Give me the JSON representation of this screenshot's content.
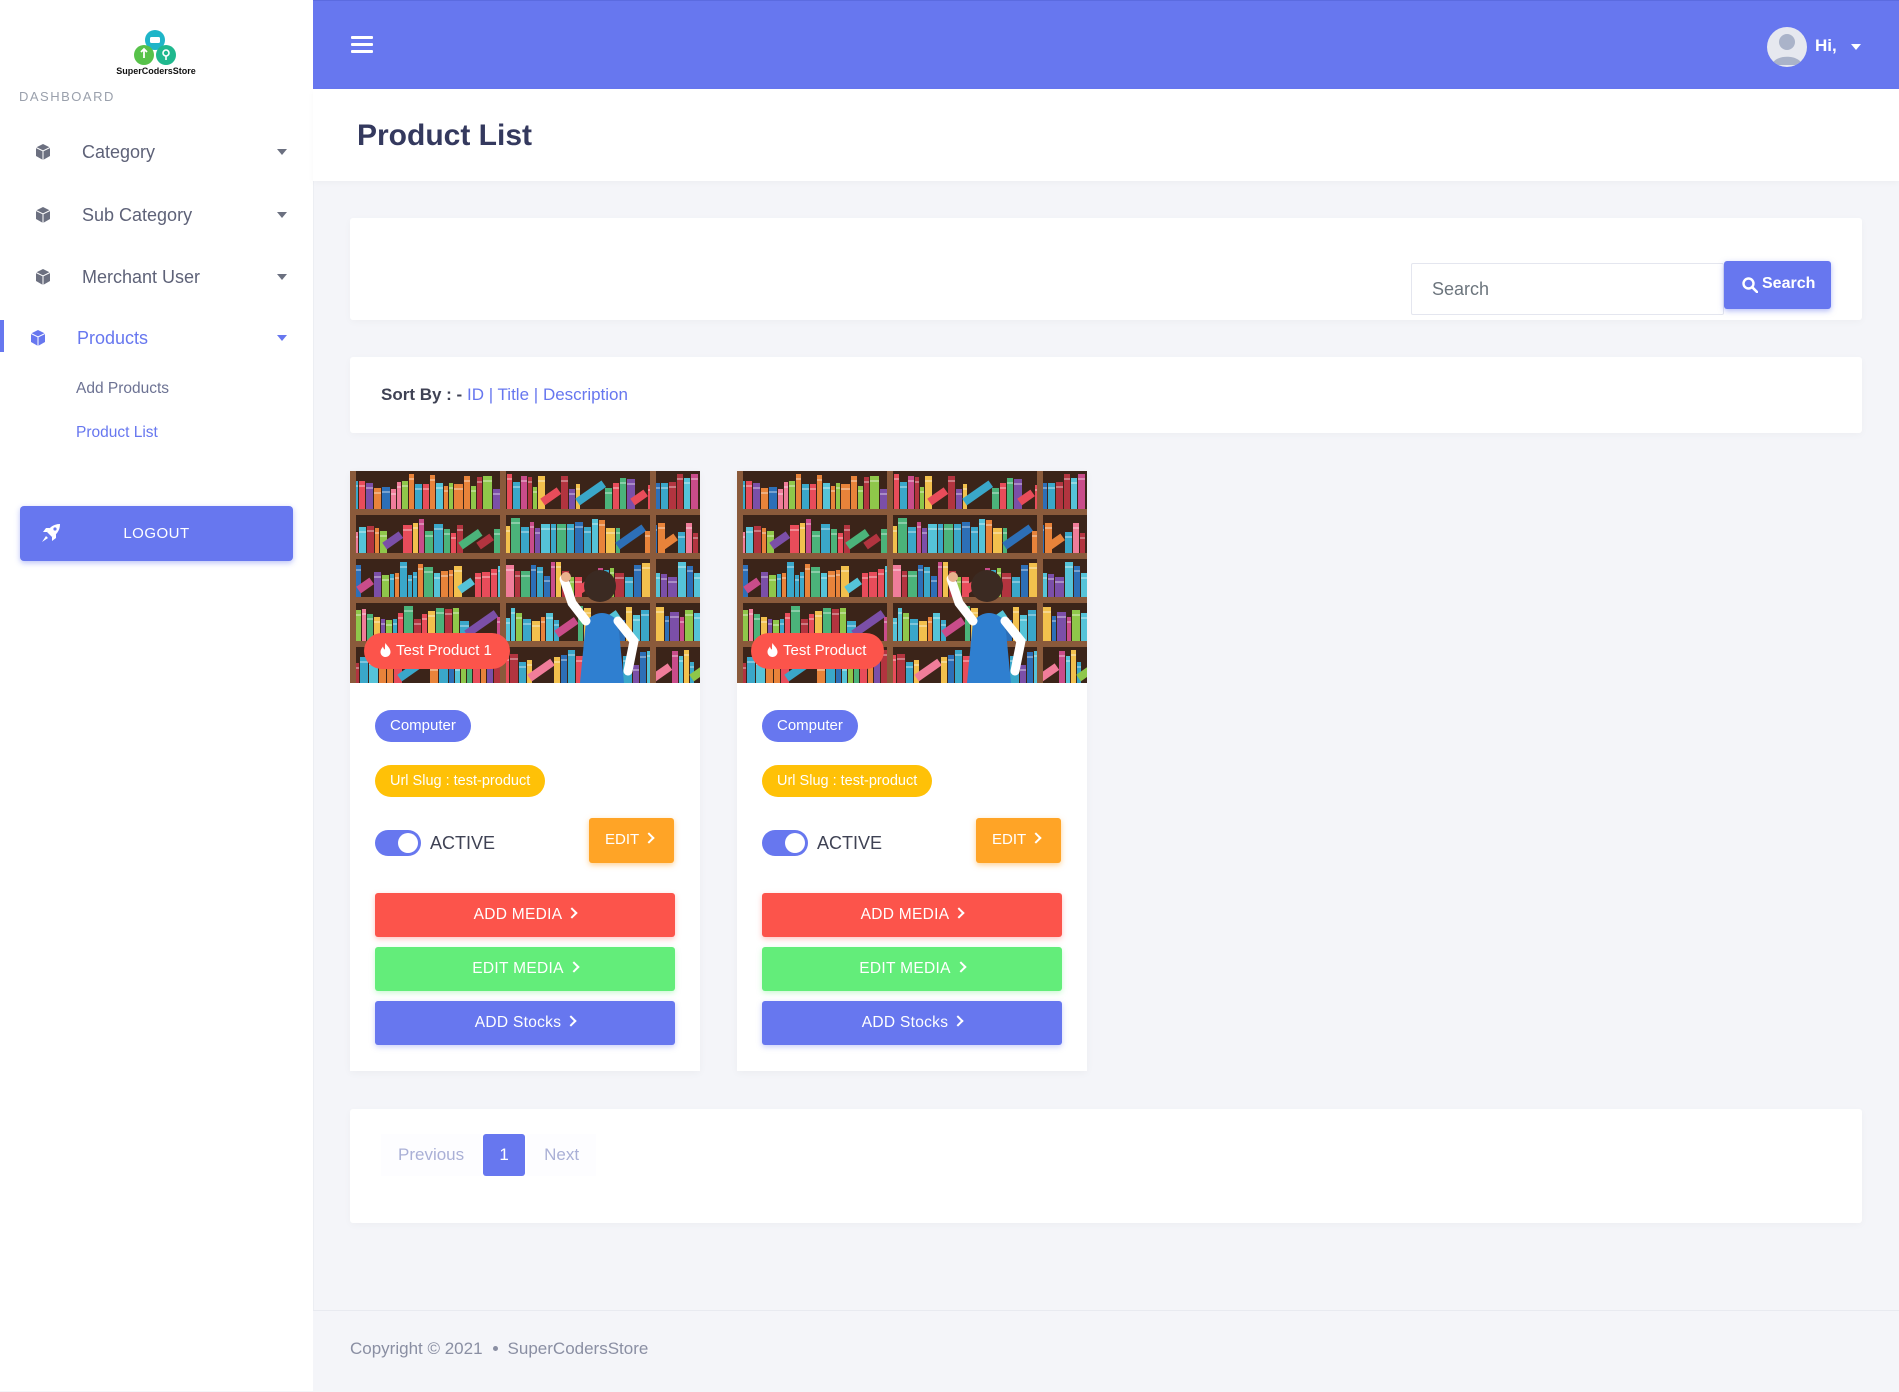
{
  "brand": {
    "name": "SuperCodersStore"
  },
  "sidebar": {
    "section_label": "DASHBOARD",
    "items": [
      {
        "label": "Category"
      },
      {
        "label": "Sub Category"
      },
      {
        "label": "Merchant User"
      },
      {
        "label": "Products"
      }
    ],
    "products_sub": [
      "Add Products",
      "Product List"
    ],
    "logout_label": "LOGOUT"
  },
  "topbar": {
    "greeting": "Hi,"
  },
  "page": {
    "title": "Product List"
  },
  "search": {
    "placeholder": "Search",
    "button_label": "Search"
  },
  "sort": {
    "label": "Sort By : -",
    "options": [
      "ID",
      "Title",
      "Description"
    ]
  },
  "products": [
    {
      "title": "Test Product 1",
      "category": "Computer",
      "slug": "Url Slug : test-product",
      "status_label": "ACTIVE",
      "active": true,
      "edit_label": "EDIT",
      "add_media_label": "ADD MEDIA",
      "edit_media_label": "EDIT MEDIA",
      "add_stocks_label": "ADD Stocks"
    },
    {
      "title": "Test Product",
      "category": "Computer",
      "slug": "Url Slug : test-product",
      "status_label": "ACTIVE",
      "active": true,
      "edit_label": "EDIT",
      "add_media_label": "ADD MEDIA",
      "edit_media_label": "EDIT MEDIA",
      "add_stocks_label": "ADD Stocks"
    }
  ],
  "pagination": {
    "previous": "Previous",
    "current": "1",
    "next": "Next"
  },
  "footer": {
    "copyright": "Copyright © 2021",
    "site": "SuperCodersStore"
  },
  "colors": {
    "primary": "#6777ef",
    "danger": "#fc544b",
    "success": "#63ed7a",
    "warning": "#ffa426",
    "badge_yellow": "#ffc107"
  }
}
